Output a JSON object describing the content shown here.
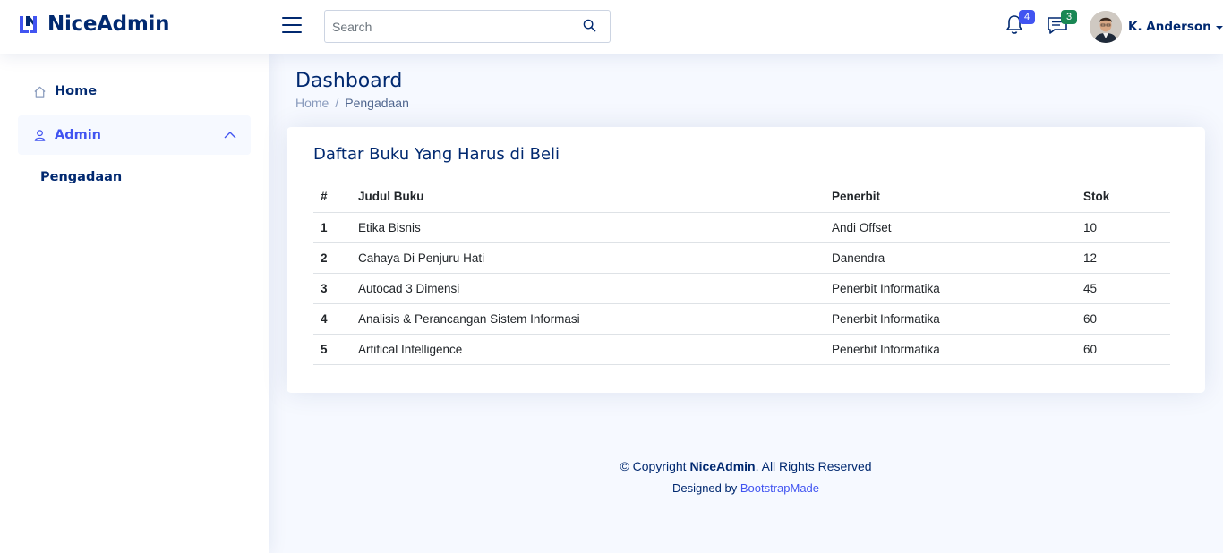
{
  "header": {
    "brand": "NiceAdmin",
    "search_placeholder": "Search",
    "search_value": "",
    "notifications_count": "4",
    "messages_count": "3",
    "user_name": "K. Anderson",
    "colors": {
      "brand": "#012970",
      "accent": "#4154f1",
      "notif_badge": "#4154f1",
      "msg_badge": "#2eca6a"
    }
  },
  "sidebar": {
    "items": [
      {
        "label": "Home",
        "icon": "house-icon"
      },
      {
        "label": "Admin",
        "icon": "person-icon",
        "expanded": true
      }
    ],
    "subitems": [
      {
        "label": "Pengadaan"
      }
    ]
  },
  "page": {
    "title": "Dashboard",
    "breadcrumb": [
      "Home",
      "Pengadaan"
    ]
  },
  "card": {
    "title": "Daftar Buku Yang Harus di Beli",
    "columns": [
      "#",
      "Judul Buku",
      "Penerbit",
      "Stok"
    ],
    "rows": [
      [
        "1",
        "Etika Bisnis",
        "Andi Offset",
        "10"
      ],
      [
        "2",
        "Cahaya Di Penjuru Hati",
        "Danendra",
        "12"
      ],
      [
        "3",
        "Autocad 3 Dimensi",
        "Penerbit Informatika",
        "45"
      ],
      [
        "4",
        "Analisis & Perancangan Sistem Informasi",
        "Penerbit Informatika",
        "60"
      ],
      [
        "5",
        "Artifical Intelligence",
        "Penerbit Informatika",
        "60"
      ]
    ]
  },
  "footer": {
    "copyright_prefix": "© Copyright ",
    "copyright_brand": "NiceAdmin",
    "copyright_suffix": ". All Rights Reserved",
    "designed_by": "Designed by ",
    "designer": "BootstrapMade"
  }
}
